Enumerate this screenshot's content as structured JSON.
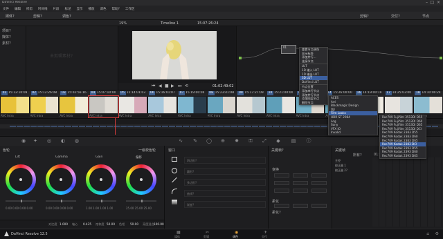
{
  "app": {
    "window_title": "DaVinci Resolve",
    "brand_label": "DaVinci Resolve 12.5"
  },
  "menubar": [
    "文件",
    "编辑",
    "修剪",
    "时间线",
    "片段",
    "标记",
    "显示",
    "播放",
    "调色",
    "帮助?",
    "工作区"
  ],
  "toolbar": {
    "left_items": [
      "媒体?",
      "剪辑?",
      "调色?"
    ],
    "zoom": "19%",
    "timeline_name": "Timeline 1",
    "timecode": "15:07:26:24",
    "right_items": [
      "剪辑?",
      "交付?",
      "节点"
    ]
  },
  "sidebar": {
    "items": [
      "项目?",
      "媒体?",
      "素材?"
    ]
  },
  "gallery": {
    "watermark": "未剪辑素材?"
  },
  "viewer": {
    "timecode": "01:02:49:02"
  },
  "nodes": {
    "node_label": "01",
    "menu_main": [
      "重置节点调色",
      "显示标签",
      "添加并行...",
      "连接节点",
      "",
      "LUT",
      "1D 输入 LUT",
      "1D 输出 LUT",
      "3D LUT",
      "DaVinci LUT",
      "",
      "节点位置",
      "添加串行节点",
      "添加并行节点",
      "添加图层节点",
      "删除节点"
    ],
    "menu_lut": [
      "ACES",
      "Arri",
      "Blackmagic Design",
      "DJI",
      "Film Looks",
      "HDR ST 2084",
      "Log",
      "Sony",
      "VFX IO",
      "Invalid"
    ],
    "menu_film": [
      "Rec709 Fujifilm 3513DI D55",
      "Rec709 Fujifilm 3513DI D60",
      "Rec709 Fujifilm 3513DI D65",
      "Rec709 Fujifilm 3513DI DCI",
      "Rec709 Kodak 2383 D55",
      "Rec709 Kodak 2383 D60",
      "Rec709 Kodak 2383 D65",
      "Rec709 Kodak 2383 DCI",
      "Rec709 Kodak 2393 D55",
      "Rec709 Kodak 2393 D60",
      "Rec709 Kodak 2393 D65"
    ]
  },
  "clips": [
    {
      "num": "01",
      "tc": "15:12:10:09",
      "label": "AVC Intra",
      "color": "#e8c23a",
      "color2": "#f3e08a"
    },
    {
      "num": "02",
      "tc": "15:12:26:08",
      "label": "AVC Intra",
      "color": "#efd04f",
      "color2": "#eae4d0"
    },
    {
      "num": "03",
      "tc": "15:02:56:16",
      "label": "AVC Intra",
      "color": "#e7c53e",
      "color2": "#f2ecd8"
    },
    {
      "num": "04",
      "tc": "15:07:10:00",
      "label": "AVC Intra",
      "color": "#c9c7c2",
      "color2": "#e1ddd6"
    },
    {
      "num": "05",
      "tc": "15:14:01:03",
      "label": "AVC Intra",
      "color": "#e9e7e3",
      "color2": "#d7a9b8"
    },
    {
      "num": "06",
      "tc": "15:16:01:07",
      "label": "AVC Intra",
      "color": "#a8c8dc",
      "color2": "#e7e4df"
    },
    {
      "num": "07",
      "tc": "15:19:00:06",
      "label": "AVC Intra",
      "color": "#7fb7d0",
      "color2": "#2a3d4c"
    },
    {
      "num": "08",
      "tc": "15:23:41:08",
      "label": "AVC Intra",
      "color": "#6aa7c0",
      "color2": "#dad6cf"
    },
    {
      "num": "09",
      "tc": "15:17:27:09",
      "label": "AVC Intra",
      "color": "#e3e1dc",
      "color2": "#b6c8d0"
    },
    {
      "num": "10",
      "tc": "15:21:00:00",
      "label": "AVC Intra",
      "color": "#5f9fb9",
      "color2": "#e9e6e1"
    },
    {
      "num": "13",
      "tc": "15:18:00:00",
      "label": "AVC Intra",
      "color": "#73b2c9",
      "color2": "#ded8cf"
    },
    {
      "num": "14",
      "tc": "15:26:00:00",
      "label": "AVC Intra",
      "color": "#6eb1c8",
      "color2": "#e8e6e2"
    },
    {
      "num": "16",
      "tc": "14:19:00:19",
      "label": "AVC Intra",
      "color": "#7ab6cd",
      "color2": "#f0ece4"
    },
    {
      "num": "17",
      "tc": "14:25:03:00",
      "label": "AVC Intra",
      "color": "#e7e4df",
      "color2": "#c8d3d8"
    },
    {
      "num": "18",
      "tc": "14:10:00:24",
      "label": "AVC Intra",
      "color": "#8cbcd0",
      "color2": "#e4e0d9"
    }
  ],
  "color_panel": {
    "title": "色轮",
    "mode": "一级校色轮",
    "wheels": [
      {
        "name": "Lift",
        "vals": "0.00  0.00  0.00  0.00"
      },
      {
        "name": "Gamma",
        "vals": "0.00  0.00  0.00  0.00"
      },
      {
        "name": "Gain",
        "vals": "1.00  1.00  1.00  1.00"
      },
      {
        "name": "偏移",
        "vals": "25.00 25.00 25.00"
      }
    ],
    "footer": [
      {
        "label": "对比度",
        "value": "1.000"
      },
      {
        "label": "轴心",
        "value": "0.435"
      },
      {
        "label": "饱和度",
        "value": "50.00"
      },
      {
        "label": "色相",
        "value": "50.00"
      },
      {
        "label": "亮度混合",
        "value": "100.00"
      }
    ]
  },
  "curves_panel": {
    "title": "窗口",
    "tools": [
      "四边形?",
      "圆形?",
      "多边形?",
      "曲线?",
      "渐变?"
    ]
  },
  "right_panel": {
    "tab": "关键帧?",
    "section1": "变换",
    "section2": "柔化",
    "section3": "柔化?"
  },
  "keyframe": {
    "title": "关键帧",
    "filter": "所有?",
    "tc": "01:02:49:02",
    "rows": [
      "主控",
      "校正器 1",
      "校正器 2?"
    ]
  },
  "pagebar": {
    "pages": [
      "媒体",
      "剪辑",
      "调色",
      "交付"
    ],
    "active": 2
  },
  "colors": {
    "accent": "#3b5fa0",
    "playhead": "#d23b3b",
    "clip_badge": "#3c5c8c"
  }
}
